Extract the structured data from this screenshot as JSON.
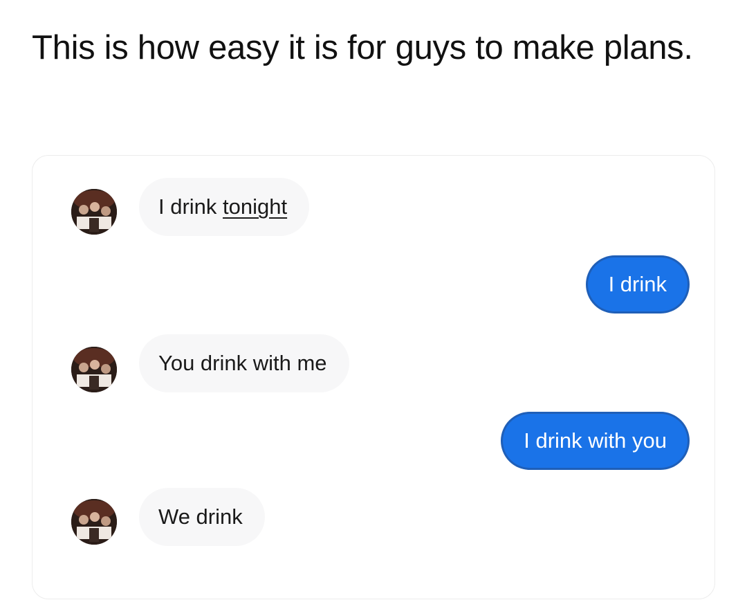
{
  "caption": "This is how easy it is for guys to make plans.",
  "messages": [
    {
      "direction": "incoming",
      "text": "I drink ",
      "underlined_text": "tonight",
      "avatar": "contact-avatar"
    },
    {
      "direction": "outgoing",
      "text": "I drink"
    },
    {
      "direction": "incoming",
      "text": "You drink with me",
      "avatar": "contact-avatar"
    },
    {
      "direction": "outgoing",
      "text": "I drink with you"
    },
    {
      "direction": "incoming",
      "text": "We drink",
      "avatar": "contact-avatar"
    }
  ],
  "colors": {
    "outgoing_bubble": "#1a73e8",
    "incoming_bubble": "#f7f7f8",
    "background": "#ffffff"
  }
}
